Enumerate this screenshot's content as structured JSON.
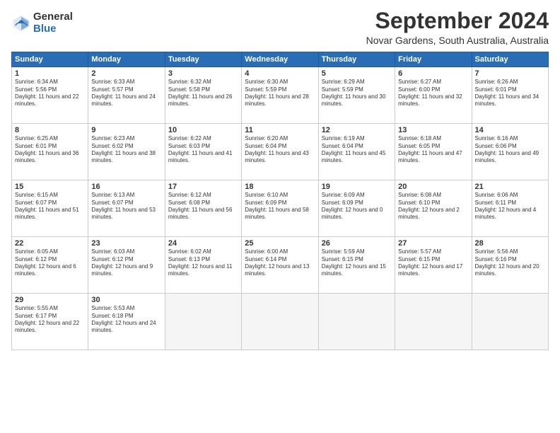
{
  "logo": {
    "general": "General",
    "blue": "Blue"
  },
  "header": {
    "month": "September 2024",
    "location": "Novar Gardens, South Australia, Australia"
  },
  "weekdays": [
    "Sunday",
    "Monday",
    "Tuesday",
    "Wednesday",
    "Thursday",
    "Friday",
    "Saturday"
  ],
  "days": [
    {
      "num": "",
      "sunrise": "",
      "sunset": "",
      "daylight": ""
    },
    {
      "num": "2",
      "sunrise": "Sunrise: 6:33 AM",
      "sunset": "Sunset: 5:57 PM",
      "daylight": "Daylight: 11 hours and 24 minutes."
    },
    {
      "num": "3",
      "sunrise": "Sunrise: 6:32 AM",
      "sunset": "Sunset: 5:58 PM",
      "daylight": "Daylight: 11 hours and 26 minutes."
    },
    {
      "num": "4",
      "sunrise": "Sunrise: 6:30 AM",
      "sunset": "Sunset: 5:59 PM",
      "daylight": "Daylight: 11 hours and 28 minutes."
    },
    {
      "num": "5",
      "sunrise": "Sunrise: 6:29 AM",
      "sunset": "Sunset: 5:59 PM",
      "daylight": "Daylight: 11 hours and 30 minutes."
    },
    {
      "num": "6",
      "sunrise": "Sunrise: 6:27 AM",
      "sunset": "Sunset: 6:00 PM",
      "daylight": "Daylight: 11 hours and 32 minutes."
    },
    {
      "num": "7",
      "sunrise": "Sunrise: 6:26 AM",
      "sunset": "Sunset: 6:01 PM",
      "daylight": "Daylight: 11 hours and 34 minutes."
    },
    {
      "num": "8",
      "sunrise": "Sunrise: 6:25 AM",
      "sunset": "Sunset: 6:01 PM",
      "daylight": "Daylight: 11 hours and 36 minutes."
    },
    {
      "num": "9",
      "sunrise": "Sunrise: 6:23 AM",
      "sunset": "Sunset: 6:02 PM",
      "daylight": "Daylight: 11 hours and 38 minutes."
    },
    {
      "num": "10",
      "sunrise": "Sunrise: 6:22 AM",
      "sunset": "Sunset: 6:03 PM",
      "daylight": "Daylight: 11 hours and 41 minutes."
    },
    {
      "num": "11",
      "sunrise": "Sunrise: 6:20 AM",
      "sunset": "Sunset: 6:04 PM",
      "daylight": "Daylight: 11 hours and 43 minutes."
    },
    {
      "num": "12",
      "sunrise": "Sunrise: 6:19 AM",
      "sunset": "Sunset: 6:04 PM",
      "daylight": "Daylight: 11 hours and 45 minutes."
    },
    {
      "num": "13",
      "sunrise": "Sunrise: 6:18 AM",
      "sunset": "Sunset: 6:05 PM",
      "daylight": "Daylight: 11 hours and 47 minutes."
    },
    {
      "num": "14",
      "sunrise": "Sunrise: 6:16 AM",
      "sunset": "Sunset: 6:06 PM",
      "daylight": "Daylight: 11 hours and 49 minutes."
    },
    {
      "num": "15",
      "sunrise": "Sunrise: 6:15 AM",
      "sunset": "Sunset: 6:07 PM",
      "daylight": "Daylight: 11 hours and 51 minutes."
    },
    {
      "num": "16",
      "sunrise": "Sunrise: 6:13 AM",
      "sunset": "Sunset: 6:07 PM",
      "daylight": "Daylight: 11 hours and 53 minutes."
    },
    {
      "num": "17",
      "sunrise": "Sunrise: 6:12 AM",
      "sunset": "Sunset: 6:08 PM",
      "daylight": "Daylight: 11 hours and 56 minutes."
    },
    {
      "num": "18",
      "sunrise": "Sunrise: 6:10 AM",
      "sunset": "Sunset: 6:09 PM",
      "daylight": "Daylight: 11 hours and 58 minutes."
    },
    {
      "num": "19",
      "sunrise": "Sunrise: 6:09 AM",
      "sunset": "Sunset: 6:09 PM",
      "daylight": "Daylight: 12 hours and 0 minutes."
    },
    {
      "num": "20",
      "sunrise": "Sunrise: 6:08 AM",
      "sunset": "Sunset: 6:10 PM",
      "daylight": "Daylight: 12 hours and 2 minutes."
    },
    {
      "num": "21",
      "sunrise": "Sunrise: 6:06 AM",
      "sunset": "Sunset: 6:11 PM",
      "daylight": "Daylight: 12 hours and 4 minutes."
    },
    {
      "num": "22",
      "sunrise": "Sunrise: 6:05 AM",
      "sunset": "Sunset: 6:12 PM",
      "daylight": "Daylight: 12 hours and 6 minutes."
    },
    {
      "num": "23",
      "sunrise": "Sunrise: 6:03 AM",
      "sunset": "Sunset: 6:12 PM",
      "daylight": "Daylight: 12 hours and 9 minutes."
    },
    {
      "num": "24",
      "sunrise": "Sunrise: 6:02 AM",
      "sunset": "Sunset: 6:13 PM",
      "daylight": "Daylight: 12 hours and 11 minutes."
    },
    {
      "num": "25",
      "sunrise": "Sunrise: 6:00 AM",
      "sunset": "Sunset: 6:14 PM",
      "daylight": "Daylight: 12 hours and 13 minutes."
    },
    {
      "num": "26",
      "sunrise": "Sunrise: 5:59 AM",
      "sunset": "Sunset: 6:15 PM",
      "daylight": "Daylight: 12 hours and 15 minutes."
    },
    {
      "num": "27",
      "sunrise": "Sunrise: 5:57 AM",
      "sunset": "Sunset: 6:15 PM",
      "daylight": "Daylight: 12 hours and 17 minutes."
    },
    {
      "num": "28",
      "sunrise": "Sunrise: 5:56 AM",
      "sunset": "Sunset: 6:16 PM",
      "daylight": "Daylight: 12 hours and 20 minutes."
    },
    {
      "num": "29",
      "sunrise": "Sunrise: 5:55 AM",
      "sunset": "Sunset: 6:17 PM",
      "daylight": "Daylight: 12 hours and 22 minutes."
    },
    {
      "num": "30",
      "sunrise": "Sunrise: 5:53 AM",
      "sunset": "Sunset: 6:18 PM",
      "daylight": "Daylight: 12 hours and 24 minutes."
    }
  ],
  "day1": {
    "num": "1",
    "sunrise": "Sunrise: 6:34 AM",
    "sunset": "Sunset: 5:56 PM",
    "daylight": "Daylight: 11 hours and 22 minutes."
  }
}
